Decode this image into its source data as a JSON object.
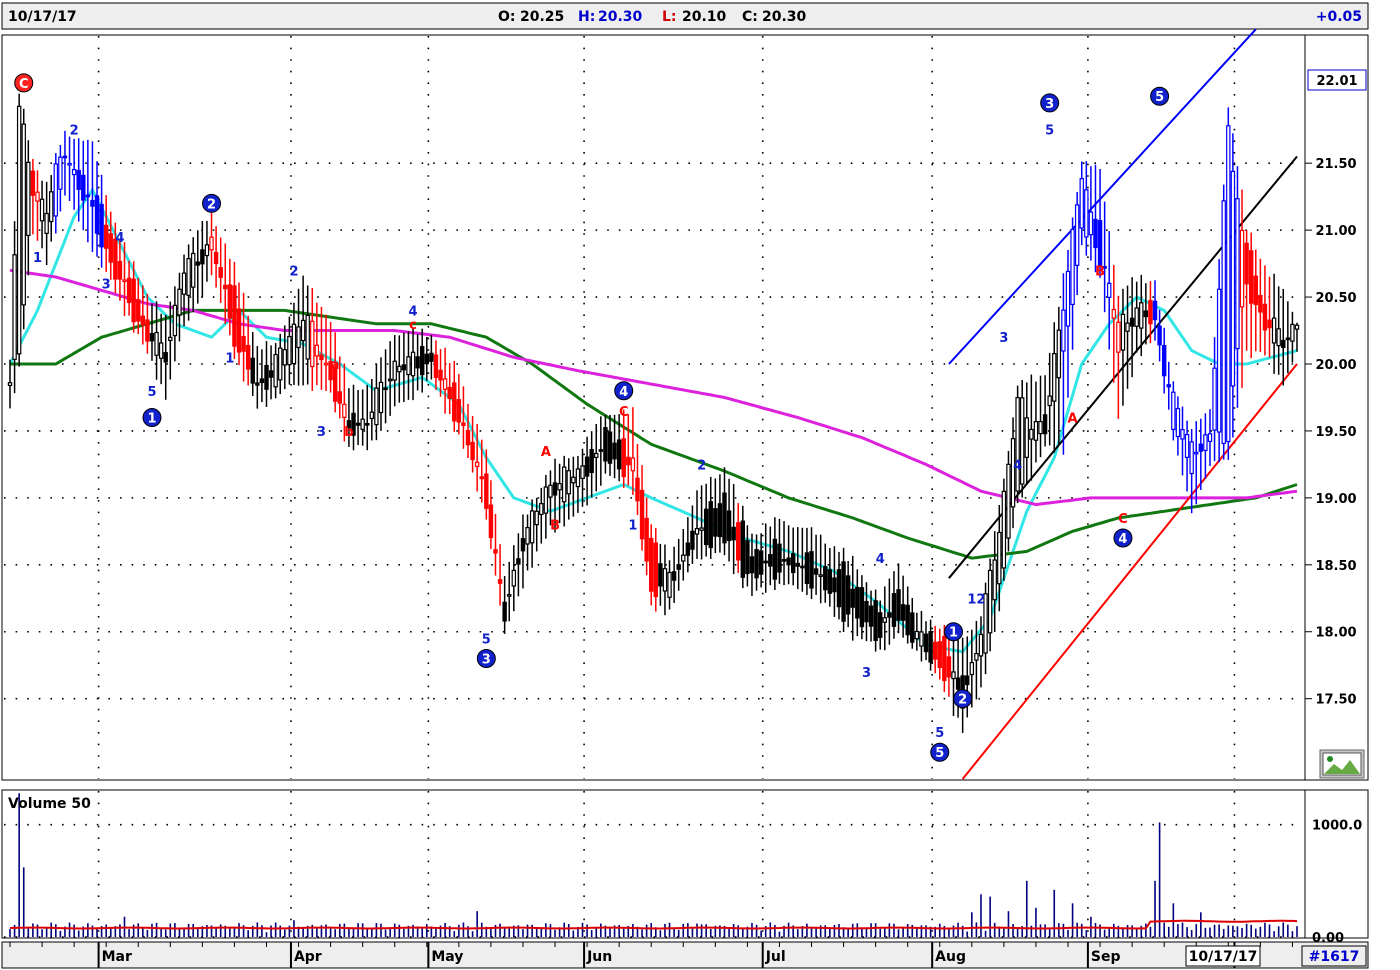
{
  "header": {
    "date": "10/17/17",
    "open_label": "O:",
    "open": "20.25",
    "high_label": "H:",
    "high": "20.30",
    "low_label": "L:",
    "low": "20.10",
    "close_label": "C:",
    "close": "20.30",
    "change": "+0.05"
  },
  "footer": {
    "date_box": "10/17/17",
    "bar_count": "#1617"
  },
  "colors": {
    "up_bar": "#000000",
    "down_bar": "#ff0000",
    "wave_bar": "#0000ff",
    "ma_fast": "#33e6e6",
    "ma_mid": "#117711",
    "ma_slow": "#dd22dd",
    "volume": "#000080",
    "volume_avg": "#dd0000",
    "price_tag": "#0000cc"
  },
  "chart_data": [
    {
      "type": "candlestick",
      "name": "price",
      "current_price_tag": "22.01",
      "ylim": [
        16.9,
        22.45
      ],
      "y_ticks": [
        17.5,
        18.0,
        18.5,
        19.0,
        19.5,
        20.0,
        20.5,
        21.0,
        21.5
      ],
      "y_tick_labels": [
        "17.50",
        "18.00",
        "18.50",
        "19.00",
        "19.50",
        "20.00",
        "20.50",
        "21.00",
        "21.50"
      ],
      "x_month_labels": [
        "Mar",
        "Apr",
        "May",
        "Jun",
        "Jul",
        "Aug",
        "Sep",
        "O"
      ],
      "x_month_index": [
        20,
        62,
        92,
        126,
        165,
        202,
        236,
        268
      ],
      "x_count": 282,
      "ohlc_anchors": [
        [
          0,
          19.8,
          20.0,
          19.7,
          19.9
        ],
        [
          2,
          20.1,
          22.0,
          20.0,
          21.9
        ],
        [
          5,
          21.4,
          21.5,
          21.0,
          21.3
        ],
        [
          8,
          20.9,
          21.3,
          20.8,
          21.2
        ],
        [
          12,
          21.5,
          21.7,
          21.3,
          21.6
        ],
        [
          18,
          21.3,
          21.6,
          20.9,
          21.1
        ],
        [
          24,
          20.8,
          20.9,
          20.5,
          20.6
        ],
        [
          30,
          20.3,
          20.5,
          20.1,
          20.2
        ],
        [
          34,
          20.0,
          20.3,
          19.8,
          20.1
        ],
        [
          38,
          20.5,
          20.8,
          20.3,
          20.7
        ],
        [
          44,
          20.9,
          21.1,
          20.7,
          20.9
        ],
        [
          50,
          20.4,
          20.6,
          20.0,
          20.1
        ],
        [
          54,
          19.9,
          20.1,
          19.7,
          19.8
        ],
        [
          58,
          19.9,
          20.1,
          19.8,
          20.0
        ],
        [
          64,
          20.1,
          20.6,
          19.9,
          20.4
        ],
        [
          70,
          20.0,
          20.3,
          19.8,
          19.9
        ],
        [
          74,
          19.6,
          19.8,
          19.4,
          19.5
        ],
        [
          78,
          19.5,
          19.8,
          19.4,
          19.6
        ],
        [
          84,
          19.9,
          20.2,
          19.7,
          20.0
        ],
        [
          92,
          20.1,
          20.2,
          19.9,
          20.0
        ],
        [
          98,
          19.7,
          19.9,
          19.5,
          19.6
        ],
        [
          104,
          19.1,
          19.3,
          18.9,
          19.0
        ],
        [
          108,
          18.2,
          18.4,
          18.0,
          18.1
        ],
        [
          112,
          18.6,
          18.8,
          18.4,
          18.7
        ],
        [
          118,
          19.0,
          19.2,
          18.8,
          19.1
        ],
        [
          124,
          19.1,
          19.3,
          18.9,
          19.2
        ],
        [
          130,
          19.5,
          19.6,
          19.2,
          19.3
        ],
        [
          136,
          19.3,
          19.6,
          19.1,
          19.2
        ],
        [
          140,
          18.7,
          18.8,
          18.2,
          18.3
        ],
        [
          144,
          18.3,
          18.5,
          18.2,
          18.4
        ],
        [
          150,
          18.8,
          19.0,
          18.6,
          18.7
        ],
        [
          156,
          19.0,
          19.2,
          18.6,
          18.7
        ],
        [
          162,
          18.6,
          18.7,
          18.3,
          18.4
        ],
        [
          168,
          18.6,
          18.8,
          18.4,
          18.5
        ],
        [
          176,
          18.5,
          18.7,
          18.3,
          18.4
        ],
        [
          184,
          18.4,
          18.5,
          18.0,
          18.1
        ],
        [
          190,
          18.1,
          18.2,
          17.9,
          18.0
        ],
        [
          194,
          18.3,
          18.5,
          18.0,
          18.1
        ],
        [
          198,
          18.0,
          18.1,
          17.9,
          17.95
        ],
        [
          204,
          17.9,
          18.0,
          17.6,
          17.7
        ],
        [
          208,
          17.6,
          17.9,
          17.3,
          17.5
        ],
        [
          212,
          17.8,
          18.1,
          17.6,
          18.0
        ],
        [
          216,
          18.3,
          18.9,
          18.2,
          18.8
        ],
        [
          220,
          19.1,
          19.8,
          19.0,
          19.7
        ],
        [
          226,
          19.6,
          19.9,
          19.4,
          19.5
        ],
        [
          230,
          20.0,
          20.6,
          19.4,
          20.5
        ],
        [
          234,
          21.0,
          21.5,
          20.9,
          21.4
        ],
        [
          238,
          21.0,
          21.4,
          20.7,
          20.8
        ],
        [
          242,
          20.1,
          20.5,
          19.6,
          20.3
        ],
        [
          246,
          20.3,
          20.6,
          20.1,
          20.4
        ],
        [
          250,
          20.5,
          20.6,
          20.2,
          20.3
        ],
        [
          254,
          19.6,
          19.8,
          19.5,
          19.7
        ],
        [
          258,
          19.2,
          19.5,
          18.9,
          19.4
        ],
        [
          262,
          19.5,
          19.6,
          19.3,
          19.4
        ],
        [
          266,
          19.4,
          21.9,
          19.3,
          21.8
        ],
        [
          270,
          20.9,
          21.0,
          20.1,
          20.6
        ],
        [
          274,
          20.4,
          20.7,
          20.1,
          20.3
        ],
        [
          278,
          20.1,
          20.5,
          19.9,
          20.2
        ],
        [
          281,
          20.25,
          20.3,
          20.1,
          20.3
        ]
      ],
      "series": [
        {
          "key": "ma_fast",
          "anchors": [
            [
              0,
              20.0
            ],
            [
              6,
              20.4
            ],
            [
              14,
              21.1
            ],
            [
              18,
              21.3
            ],
            [
              24,
              20.9
            ],
            [
              30,
              20.5
            ],
            [
              36,
              20.3
            ],
            [
              44,
              20.2
            ],
            [
              50,
              20.4
            ],
            [
              56,
              20.2
            ],
            [
              64,
              20.15
            ],
            [
              72,
              20.0
            ],
            [
              80,
              19.8
            ],
            [
              90,
              19.9
            ],
            [
              98,
              19.7
            ],
            [
              104,
              19.3
            ],
            [
              110,
              19.0
            ],
            [
              118,
              18.9
            ],
            [
              126,
              19.0
            ],
            [
              134,
              19.1
            ],
            [
              140,
              19.0
            ],
            [
              150,
              18.85
            ],
            [
              160,
              18.7
            ],
            [
              170,
              18.6
            ],
            [
              180,
              18.45
            ],
            [
              190,
              18.2
            ],
            [
              200,
              17.9
            ],
            [
              208,
              17.85
            ],
            [
              214,
              18.1
            ],
            [
              222,
              18.9
            ],
            [
              228,
              19.3
            ],
            [
              234,
              20.0
            ],
            [
              240,
              20.3
            ],
            [
              246,
              20.5
            ],
            [
              252,
              20.4
            ],
            [
              258,
              20.1
            ],
            [
              264,
              20.0
            ],
            [
              270,
              20.0
            ],
            [
              281,
              20.1
            ]
          ]
        },
        {
          "key": "ma_mid",
          "anchors": [
            [
              0,
              20.0
            ],
            [
              10,
              20.0
            ],
            [
              20,
              20.2
            ],
            [
              30,
              20.3
            ],
            [
              40,
              20.4
            ],
            [
              50,
              20.4
            ],
            [
              60,
              20.4
            ],
            [
              70,
              20.35
            ],
            [
              80,
              20.3
            ],
            [
              92,
              20.3
            ],
            [
              104,
              20.2
            ],
            [
              114,
              20.0
            ],
            [
              126,
              19.7
            ],
            [
              140,
              19.4
            ],
            [
              156,
              19.2
            ],
            [
              170,
              19.0
            ],
            [
              184,
              18.85
            ],
            [
              196,
              18.7
            ],
            [
              210,
              18.55
            ],
            [
              222,
              18.6
            ],
            [
              232,
              18.75
            ],
            [
              242,
              18.85
            ],
            [
              252,
              18.9
            ],
            [
              262,
              18.95
            ],
            [
              272,
              19.0
            ],
            [
              281,
              19.1
            ]
          ]
        },
        {
          "key": "ma_slow",
          "anchors": [
            [
              0,
              20.7
            ],
            [
              10,
              20.65
            ],
            [
              20,
              20.55
            ],
            [
              30,
              20.45
            ],
            [
              40,
              20.4
            ],
            [
              50,
              20.3
            ],
            [
              60,
              20.25
            ],
            [
              70,
              20.25
            ],
            [
              84,
              20.25
            ],
            [
              96,
              20.2
            ],
            [
              110,
              20.05
            ],
            [
              124,
              19.95
            ],
            [
              140,
              19.85
            ],
            [
              156,
              19.75
            ],
            [
              172,
              19.6
            ],
            [
              186,
              19.45
            ],
            [
              200,
              19.25
            ],
            [
              212,
              19.05
            ],
            [
              224,
              18.95
            ],
            [
              236,
              19.0
            ],
            [
              248,
              19.0
            ],
            [
              260,
              19.0
            ],
            [
              270,
              19.0
            ],
            [
              281,
              19.05
            ]
          ]
        }
      ],
      "trend_lines": [
        {
          "color": "#0000ff",
          "from": [
            205,
            20.0
          ],
          "to": [
            272,
            22.5
          ]
        },
        {
          "color": "#000000",
          "from": [
            205,
            18.4
          ],
          "to": [
            281,
            21.55
          ]
        },
        {
          "color": "#ff0000",
          "from": [
            208,
            16.9
          ],
          "to": [
            281,
            20.0
          ]
        }
      ],
      "wave_labels": [
        {
          "text": "C",
          "x": 3,
          "y": 22.1,
          "style": "circle-red"
        },
        {
          "text": "2",
          "x": 14,
          "y": 21.75,
          "style": "text-blue"
        },
        {
          "text": "1",
          "x": 6,
          "y": 20.8,
          "style": "text-blue"
        },
        {
          "text": "4",
          "x": 24,
          "y": 20.95,
          "style": "text-blue"
        },
        {
          "text": "3",
          "x": 21,
          "y": 20.6,
          "style": "text-blue"
        },
        {
          "text": "5",
          "x": 31,
          "y": 19.8,
          "style": "text-blue"
        },
        {
          "text": "1",
          "x": 31,
          "y": 19.6,
          "style": "circle-blue"
        },
        {
          "text": "2",
          "x": 44,
          "y": 21.2,
          "style": "circle-blue"
        },
        {
          "text": "1",
          "x": 48,
          "y": 20.05,
          "style": "text-blue"
        },
        {
          "text": "2",
          "x": 62,
          "y": 20.7,
          "style": "text-blue"
        },
        {
          "text": "a",
          "x": 71,
          "y": 20.0,
          "style": "text-red"
        },
        {
          "text": "3",
          "x": 68,
          "y": 19.5,
          "style": "text-blue"
        },
        {
          "text": "b",
          "x": 74,
          "y": 19.5,
          "style": "text-red"
        },
        {
          "text": "4",
          "x": 88,
          "y": 20.4,
          "style": "text-blue"
        },
        {
          "text": "c",
          "x": 88,
          "y": 20.3,
          "style": "text-red"
        },
        {
          "text": "5",
          "x": 104,
          "y": 17.95,
          "style": "text-blue"
        },
        {
          "text": "3",
          "x": 104,
          "y": 17.8,
          "style": "circle-blue"
        },
        {
          "text": "A",
          "x": 117,
          "y": 19.35,
          "style": "text-red"
        },
        {
          "text": "B",
          "x": 119,
          "y": 18.8,
          "style": "text-red"
        },
        {
          "text": "C",
          "x": 134,
          "y": 19.65,
          "style": "text-red"
        },
        {
          "text": "4",
          "x": 134,
          "y": 19.8,
          "style": "circle-blue"
        },
        {
          "text": "1",
          "x": 136,
          "y": 18.8,
          "style": "text-blue"
        },
        {
          "text": "2",
          "x": 151,
          "y": 19.25,
          "style": "text-blue"
        },
        {
          "text": "4",
          "x": 190,
          "y": 18.55,
          "style": "text-blue"
        },
        {
          "text": "3",
          "x": 187,
          "y": 17.7,
          "style": "text-blue"
        },
        {
          "text": "1",
          "x": 206,
          "y": 18.0,
          "style": "circle-blue"
        },
        {
          "text": "2",
          "x": 208,
          "y": 17.5,
          "style": "circle-blue"
        },
        {
          "text": "5",
          "x": 203,
          "y": 17.25,
          "style": "text-blue"
        },
        {
          "text": "5",
          "x": 203,
          "y": 17.1,
          "style": "circle-blue"
        },
        {
          "text": "12",
          "x": 211,
          "y": 18.25,
          "style": "text-blue"
        },
        {
          "text": "3",
          "x": 217,
          "y": 20.2,
          "style": "text-blue"
        },
        {
          "text": "4",
          "x": 220,
          "y": 19.25,
          "style": "text-blue"
        },
        {
          "text": "3",
          "x": 227,
          "y": 21.95,
          "style": "circle-blue"
        },
        {
          "text": "5",
          "x": 227,
          "y": 21.75,
          "style": "text-blue"
        },
        {
          "text": "A",
          "x": 232,
          "y": 19.6,
          "style": "text-red"
        },
        {
          "text": "B",
          "x": 238,
          "y": 20.7,
          "style": "text-red"
        },
        {
          "text": "C",
          "x": 243,
          "y": 18.85,
          "style": "text-red"
        },
        {
          "text": "4",
          "x": 243,
          "y": 18.7,
          "style": "circle-blue"
        },
        {
          "text": "5",
          "x": 251,
          "y": 22.0,
          "style": "circle-blue"
        }
      ]
    },
    {
      "type": "bar",
      "name": "volume",
      "title": "Volume 50",
      "ylim": [
        0,
        1300
      ],
      "y_ticks": [
        0,
        1000
      ],
      "y_tick_labels": [
        "0.00",
        "1000.0"
      ],
      "spikes": [
        [
          2,
          1280
        ],
        [
          3,
          620
        ],
        [
          25,
          180
        ],
        [
          62,
          150
        ],
        [
          102,
          230
        ],
        [
          150,
          120
        ],
        [
          210,
          220
        ],
        [
          212,
          380
        ],
        [
          214,
          360
        ],
        [
          218,
          230
        ],
        [
          222,
          500
        ],
        [
          224,
          260
        ],
        [
          228,
          420
        ],
        [
          232,
          300
        ],
        [
          236,
          180
        ],
        [
          250,
          500
        ],
        [
          251,
          1020
        ],
        [
          254,
          300
        ],
        [
          260,
          220
        ]
      ],
      "avg_level": 20
    }
  ]
}
